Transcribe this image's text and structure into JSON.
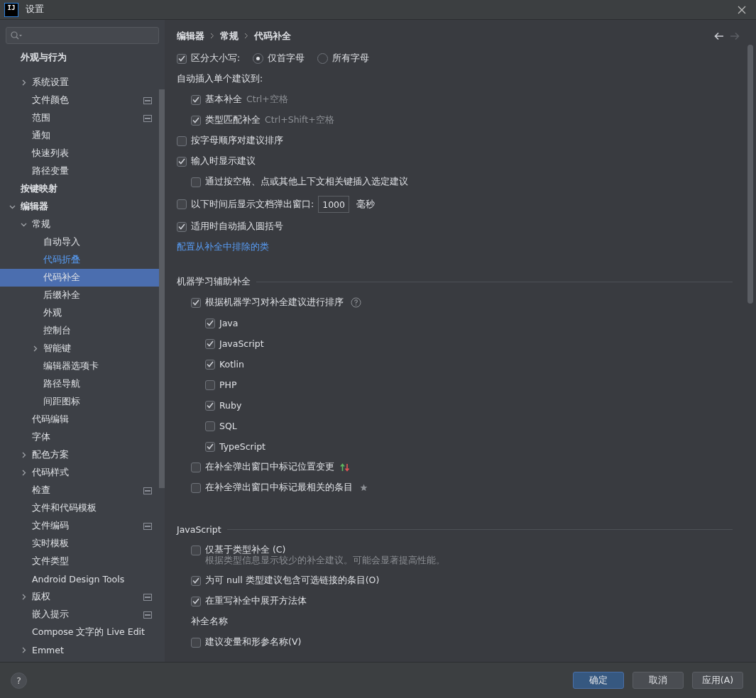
{
  "window": {
    "title": "设置",
    "logo": "IJ"
  },
  "sidebar": {
    "items": [
      {
        "label": "外观与行为",
        "selected": false,
        "modified": false,
        "badge": false,
        "children": [
          {
            "label": "系统设置",
            "selected": false,
            "modified": false,
            "badge": false,
            "expanded": false
          },
          {
            "label": "文件颜色",
            "selected": false,
            "modified": false,
            "badge": true
          },
          {
            "label": "范围",
            "selected": false,
            "modified": false,
            "badge": true
          },
          {
            "label": "通知",
            "selected": false,
            "modified": false,
            "badge": false
          },
          {
            "label": "快速列表",
            "selected": false,
            "modified": false,
            "badge": false
          },
          {
            "label": "路径变量",
            "selected": false,
            "modified": false,
            "badge": false
          }
        ]
      },
      {
        "label": "按键映射",
        "selected": false,
        "modified": false,
        "badge": false
      },
      {
        "label": "编辑器",
        "selected": false,
        "modified": false,
        "badge": false,
        "expanded": true,
        "children": [
          {
            "label": "常规",
            "selected": false,
            "modified": false,
            "badge": false,
            "expanded": true,
            "children": [
              {
                "label": "自动导入",
                "selected": false,
                "modified": false,
                "badge": false
              },
              {
                "label": "代码折叠",
                "selected": false,
                "modified": true,
                "badge": false
              },
              {
                "label": "代码补全",
                "selected": true,
                "modified": false,
                "badge": false
              },
              {
                "label": "后缀补全",
                "selected": false,
                "modified": false,
                "badge": false
              },
              {
                "label": "外观",
                "selected": false,
                "modified": false,
                "badge": false
              },
              {
                "label": "控制台",
                "selected": false,
                "modified": false,
                "badge": false
              },
              {
                "label": "智能键",
                "selected": false,
                "modified": false,
                "badge": false,
                "expanded": false
              },
              {
                "label": "编辑器选项卡",
                "selected": false,
                "modified": false,
                "badge": false
              },
              {
                "label": "路径导航",
                "selected": false,
                "modified": false,
                "badge": false
              },
              {
                "label": "间距图标",
                "selected": false,
                "modified": false,
                "badge": false
              }
            ]
          },
          {
            "label": "代码编辑",
            "selected": false,
            "modified": false,
            "badge": false
          },
          {
            "label": "字体",
            "selected": false,
            "modified": false,
            "badge": false
          },
          {
            "label": "配色方案",
            "selected": false,
            "modified": false,
            "badge": false,
            "expanded": false
          },
          {
            "label": "代码样式",
            "selected": false,
            "modified": false,
            "badge": false,
            "expanded": false
          },
          {
            "label": "检查",
            "selected": false,
            "modified": false,
            "badge": true
          },
          {
            "label": "文件和代码模板",
            "selected": false,
            "modified": false,
            "badge": false
          },
          {
            "label": "文件编码",
            "selected": false,
            "modified": false,
            "badge": true
          },
          {
            "label": "实时模板",
            "selected": false,
            "modified": false,
            "badge": false
          },
          {
            "label": "文件类型",
            "selected": false,
            "modified": false,
            "badge": false
          },
          {
            "label": "Android Design Tools",
            "selected": false,
            "modified": false,
            "badge": false
          },
          {
            "label": "版权",
            "selected": false,
            "modified": false,
            "badge": true,
            "expanded": false
          },
          {
            "label": "嵌入提示",
            "selected": false,
            "modified": false,
            "badge": true
          },
          {
            "label": "Compose 文字的 Live Edit",
            "selected": false,
            "modified": false,
            "badge": false
          },
          {
            "label": "Emmet",
            "selected": false,
            "modified": false,
            "badge": false,
            "expanded": false
          }
        ]
      }
    ]
  },
  "breadcrumb": [
    "编辑器",
    "常规",
    "代码补全"
  ],
  "nav": {
    "back_disabled": false,
    "forward_disabled": true
  },
  "settings": [
    {
      "kind": "radio",
      "label": "区分大小写:",
      "checked": true,
      "options": [
        {
          "label": "仅首字母",
          "selected": true
        },
        {
          "label": "所有字母",
          "selected": false
        }
      ]
    },
    {
      "kind": "label",
      "label": "自动插入单个建议到:",
      "children": [
        {
          "kind": "checkbox",
          "label": "基本补全",
          "shortcut": "Ctrl+空格",
          "checked": true
        },
        {
          "kind": "checkbox",
          "label": "类型匹配补全",
          "shortcut": "Ctrl+Shift+空格",
          "checked": true
        }
      ]
    },
    {
      "kind": "checkbox",
      "label": "按字母顺序对建议排序",
      "checked": false
    },
    {
      "kind": "checkbox",
      "label": "输入时显示建议",
      "checked": true,
      "children": [
        {
          "kind": "checkbox",
          "label": "通过按空格、点或其他上下文相关键插入选定建议",
          "checked": false
        }
      ]
    },
    {
      "kind": "field",
      "label": "以下时间后显示文档弹出窗口:",
      "checked": false,
      "value": "1000",
      "unit": "毫秒"
    },
    {
      "kind": "checkbox",
      "label": "适用时自动插入圆括号",
      "checked": true
    },
    {
      "kind": "link",
      "label": "配置从补全中排除的类"
    }
  ],
  "sections": [
    {
      "title": "机器学习辅助补全",
      "items": [
        {
          "kind": "checkbox",
          "label": "根据机器学习对补全建议进行排序",
          "checked": true,
          "help": true,
          "children": [
            {
              "kind": "checkbox",
              "label": "Java",
              "checked": true
            },
            {
              "kind": "checkbox",
              "label": "JavaScript",
              "checked": true
            },
            {
              "kind": "checkbox",
              "label": "Kotlin",
              "checked": true
            },
            {
              "kind": "checkbox",
              "label": "PHP",
              "checked": false
            },
            {
              "kind": "checkbox",
              "label": "Ruby",
              "checked": true
            },
            {
              "kind": "checkbox",
              "label": "SQL",
              "checked": false
            },
            {
              "kind": "checkbox",
              "label": "TypeScript",
              "checked": true
            }
          ]
        },
        {
          "kind": "checkbox",
          "label": "在补全弹出窗口中标记位置变更",
          "checked": false,
          "change_marker": true
        },
        {
          "kind": "checkbox",
          "label": "在补全弹出窗口中标记最相关的条目",
          "checked": false,
          "star_marker": true
        }
      ]
    },
    {
      "title": "JavaScript",
      "items": [
        {
          "kind": "checkbox",
          "label": "仅基于类型补全 (C)",
          "checked": false,
          "note": "根据类型信息显示较少的补全建议。可能会显著提高性能。"
        },
        {
          "kind": "checkbox",
          "label": "为可 null 类型建议包含可选链接的条目(O)",
          "checked": true
        },
        {
          "kind": "checkbox",
          "label": "在重写补全中展开方法体",
          "checked": true
        },
        {
          "kind": "label",
          "label": "补全名称"
        },
        {
          "kind": "checkbox",
          "label": "建议变量和形参名称(V)",
          "checked": false
        }
      ]
    }
  ],
  "footer": {
    "help": "?",
    "buttons": [
      {
        "label": "确定",
        "primary": true
      },
      {
        "label": "取消",
        "primary": false
      },
      {
        "label": "应用(A)",
        "primary": false
      }
    ]
  }
}
